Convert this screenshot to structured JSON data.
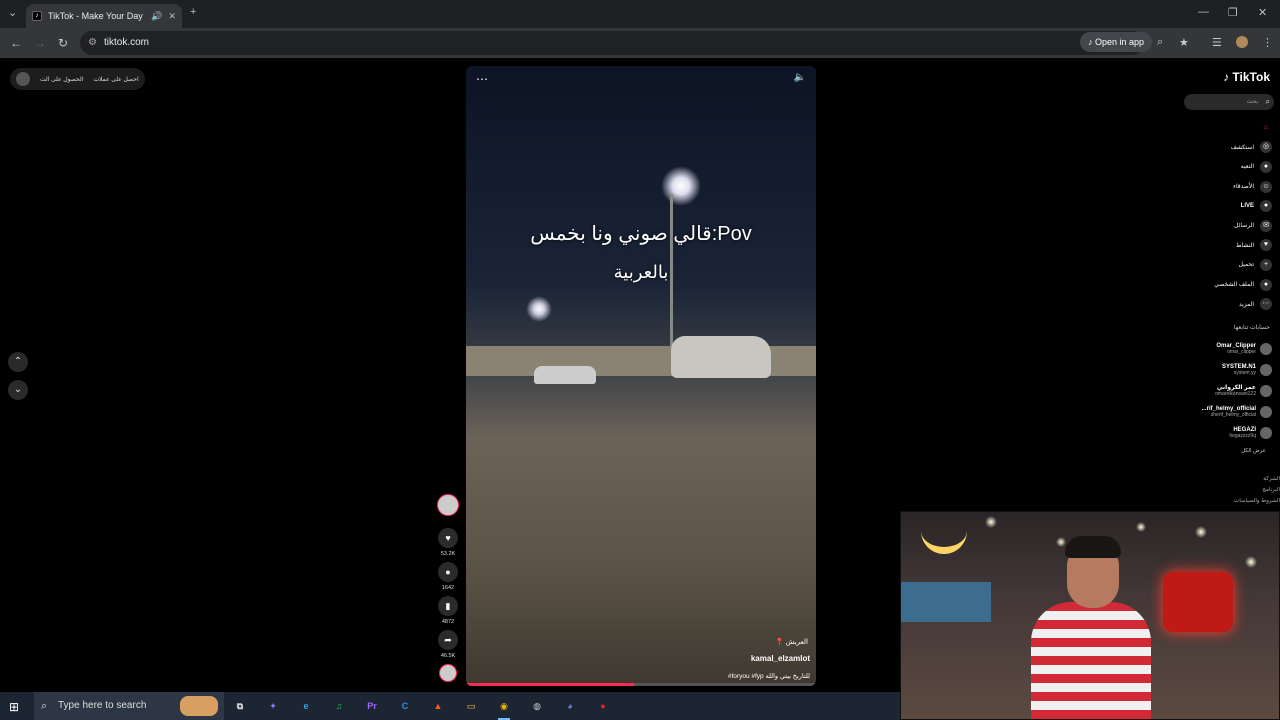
{
  "browser": {
    "tab_title": "TikTok - Make Your Day",
    "url": "tiktok.com",
    "open_in_app": "Open in app"
  },
  "page": {
    "top_left_items": [
      "احصل على عملات",
      "الحصول على الت"
    ],
    "video": {
      "overlay_line1": "قالي صوني ونا بخمس:Pov",
      "overlay_line2": "بالعربية",
      "location": "العريش",
      "username": "kamal_elzamlot",
      "description": "#foryou #fyp للتاريخ بيتي والله",
      "progress_fraction": 0.48
    },
    "actions": [
      {
        "icon": "heart-icon",
        "glyph": "♥",
        "count": "53.2K"
      },
      {
        "icon": "comment-icon",
        "glyph": "●",
        "count": "1642"
      },
      {
        "icon": "bookmark-icon",
        "glyph": "▮",
        "count": "4872"
      },
      {
        "icon": "share-icon",
        "glyph": "➦",
        "count": "46.5K"
      }
    ],
    "sidebar": {
      "logo": "TikTok",
      "search_placeholder": "بحث",
      "menu": [
        {
          "label": "",
          "icon": "home-icon",
          "glyph": "⌂"
        },
        {
          "label": "استكشف",
          "icon": "explore-icon",
          "glyph": "◎"
        },
        {
          "label": "التعيه",
          "icon": "following-icon",
          "glyph": "●"
        },
        {
          "label": "الأصدقاء",
          "icon": "friends-icon",
          "glyph": "☺"
        },
        {
          "label": "LIVE",
          "icon": "live-icon",
          "glyph": "●"
        },
        {
          "label": "الرسائل",
          "icon": "messages-icon",
          "glyph": "✉"
        },
        {
          "label": "النشاط",
          "icon": "activity-icon",
          "glyph": "♥"
        },
        {
          "label": "تحميل",
          "icon": "upload-icon",
          "glyph": "+"
        },
        {
          "label": "الملف الشخصي",
          "icon": "profile-icon",
          "glyph": "●"
        },
        {
          "label": "المزيد",
          "icon": "more-icon",
          "glyph": "⋯"
        }
      ],
      "following_title": "حسابات تتابعها",
      "following": [
        {
          "name": "Omar_Clipper",
          "handle": "omar_clipper"
        },
        {
          "name": "SYSTEM.N1",
          "handle": "system.yy"
        },
        {
          "name": "عمر الكرواني",
          "handle": "omarelkarwani122"
        },
        {
          "name": "...rif_helmy_official",
          "handle": "sherif_helmy_official"
        },
        {
          "name": "HEGAZI",
          "handle": "hegazzzz9q"
        }
      ],
      "see_all": "عرض الكل",
      "legal": [
        "الشركة",
        "البرنامج",
        "الشروط والسياسات"
      ]
    }
  },
  "taskbar": {
    "search_placeholder": "Type here to search",
    "apps": [
      {
        "name": "task-view",
        "glyph": "⧉",
        "color": "#dddddd"
      },
      {
        "name": "copilot",
        "glyph": "✦",
        "color": "#8a7bff"
      },
      {
        "name": "edge",
        "glyph": "e",
        "color": "#2ba7e6"
      },
      {
        "name": "spotify",
        "glyph": "♫",
        "color": "#1db954"
      },
      {
        "name": "premiere",
        "glyph": "Pr",
        "color": "#9b6cff"
      },
      {
        "name": "capcut",
        "glyph": "C",
        "color": "#3b8de0"
      },
      {
        "name": "brave",
        "glyph": "▲",
        "color": "#ff5a1f"
      },
      {
        "name": "file-explorer",
        "glyph": "▭",
        "color": "#f5c542"
      },
      {
        "name": "chrome",
        "glyph": "◉",
        "color": "#f2b600"
      },
      {
        "name": "obs",
        "glyph": "◍",
        "color": "#cccccc"
      },
      {
        "name": "discord",
        "glyph": "◕",
        "color": "#7289da"
      },
      {
        "name": "recorder",
        "glyph": "●",
        "color": "#e02424"
      }
    ]
  }
}
